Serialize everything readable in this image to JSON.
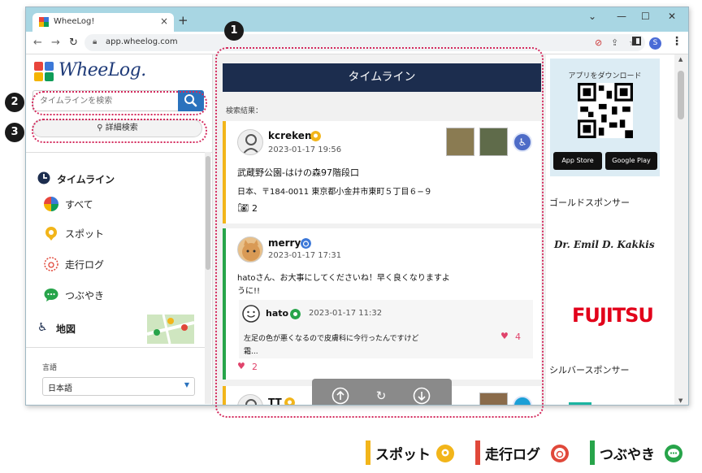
{
  "browser": {
    "tab_title": "WheeLog!",
    "new_tab": "+",
    "url": "app.wheelog.com",
    "profile_initial": "S",
    "window_controls": [
      "⌄",
      "—",
      "☐",
      "✕"
    ]
  },
  "sidebar": {
    "logo_text": "WheeLog.",
    "search_placeholder": "タイムラインを検索",
    "detail_search": "詳細検索",
    "timeline_heading": "タイムライン",
    "items": [
      {
        "label": "すべて",
        "icon": "all-categories-icon"
      },
      {
        "label": "スポット",
        "icon": "spot-pin-icon"
      },
      {
        "label": "走行ログ",
        "icon": "travel-log-icon"
      },
      {
        "label": "つぶやき",
        "icon": "tweet-bubble-icon"
      }
    ],
    "map_heading": "地図",
    "language_label": "言語",
    "language_value": "日本語"
  },
  "main": {
    "header": "タイムライン",
    "results_label": "検索結果：",
    "posts": [
      {
        "user": "kcreken",
        "date": "2023-01-17 19:56",
        "title": "武蔵野公園-はけの森97階段口",
        "address": "日本、〒184-0011 東京都小金井市東町５丁目６−９",
        "photo_count": "2",
        "category": "spot"
      },
      {
        "user": "merry",
        "date": "2023-01-17 17:31",
        "text_line1": "hatoさん、お大事にしてくださいね！早く良くなりますよ",
        "text_line2": "うに!!",
        "reply": {
          "user": "hato",
          "date": "2023-01-17 11:32",
          "text_line1": "左足の色が悪くなるので皮膚科に今行ったんですけど",
          "text_line2": "霜...",
          "likes": "4"
        },
        "likes": "2",
        "category": "tweet"
      },
      {
        "user": "TT",
        "category": "spot"
      }
    ],
    "float_controls": [
      "scroll-up-icon",
      "refresh-icon",
      "scroll-down-icon"
    ]
  },
  "right": {
    "download_title": "アプリをダウンロード",
    "app_store": "App Store",
    "google_play": "Google Play",
    "gold_label": "ゴールドスポンサー",
    "sponsor1": "Dr. Emil D. Kakkis",
    "sponsor2": "FUJITSU",
    "silver_label": "シルバースポンサー"
  },
  "annotations": [
    "1",
    "2",
    "3"
  ],
  "legend": [
    {
      "label": "スポット",
      "color": "#f2b51a"
    },
    {
      "label": "走行ログ",
      "color": "#e0483a"
    },
    {
      "label": "つぶやき",
      "color": "#27a44a"
    }
  ],
  "colors": {
    "header_bg": "#1c2d4e",
    "search_btn": "#2a72bd",
    "annotation": "#d42b5e",
    "spot": "#f2b51a",
    "travel": "#e0483a",
    "tweet": "#27a44a"
  }
}
